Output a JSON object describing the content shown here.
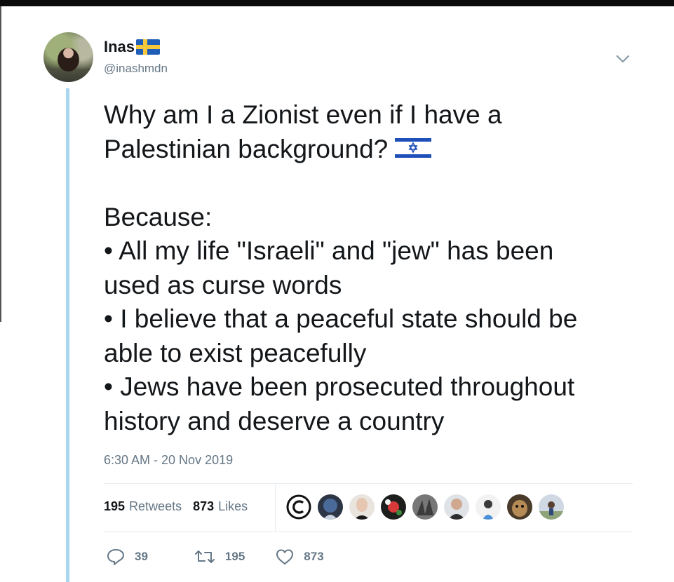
{
  "user": {
    "name": "Inas",
    "handle": "@inashmdn",
    "flag_icon": "sweden-flag-icon",
    "avatar_icon": "profile-photo"
  },
  "tweet": {
    "lines": [
      "Why am I a Zionist even if I have a",
      "Palestinian background?",
      "",
      "Because:",
      "• All my life \"Israeli\" and \"jew\" has been",
      "used as curse words",
      "• I believe that a peaceful state should be",
      "able to exist peacefully",
      "• Jews have been prosecuted throughout",
      "history and deserve a country"
    ],
    "inline_emoji": "israel-flag-icon",
    "timestamp": "6:30 AM - 20 Nov 2019"
  },
  "stats": {
    "retweets_count": "195",
    "retweets_label": "Retweets",
    "likes_count": "873",
    "likes_label": "Likes"
  },
  "likers": [
    "copyright-avatar",
    "astronaut-avatar",
    "woman-avatar",
    "flower-avatar",
    "hands-avatar",
    "man-avatar",
    "person-avatar",
    "dog-avatar",
    "outdoor-avatar"
  ],
  "actions": {
    "reply_count": "39",
    "retweet_count": "195",
    "like_count": "873"
  },
  "colors": {
    "thread_line": "#a8d6f0",
    "secondary_text": "#657786",
    "primary_text": "#14171a"
  }
}
